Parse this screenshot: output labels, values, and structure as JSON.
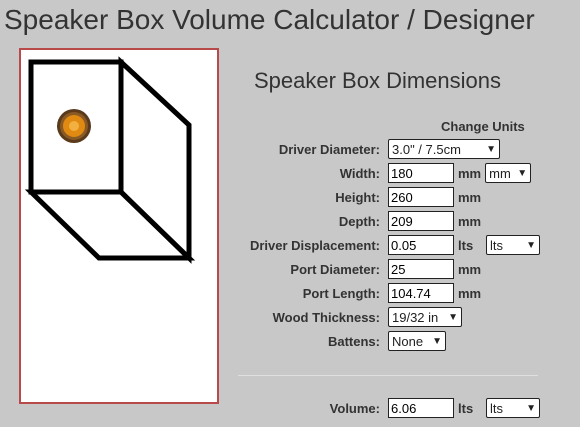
{
  "page": {
    "title": "Speaker Box Volume Calculator / Designer"
  },
  "form": {
    "title": "Speaker Box Dimensions",
    "change_units_label": "Change Units",
    "driver_diameter": {
      "label": "Driver Diameter:",
      "value": "3.0\" / 7.5cm"
    },
    "width": {
      "label": "Width:",
      "value": "180",
      "unit": "mm",
      "unit_select": "mm"
    },
    "height": {
      "label": "Height:",
      "value": "260",
      "unit": "mm"
    },
    "depth": {
      "label": "Depth:",
      "value": "209",
      "unit": "mm"
    },
    "driver_displacement": {
      "label": "Driver Displacement:",
      "value": "0.05",
      "unit": "lts",
      "unit_select": "lts"
    },
    "port_diameter": {
      "label": "Port Diameter:",
      "value": "25",
      "unit": "mm"
    },
    "port_length": {
      "label": "Port Length:",
      "value": "104.74",
      "unit": "mm"
    },
    "wood_thickness": {
      "label": "Wood Thickness:",
      "value": "19/32 in"
    },
    "battens": {
      "label": "Battens:",
      "value": "None"
    },
    "volume": {
      "label": "Volume:",
      "value": "6.06",
      "unit": "lts",
      "unit_select": "lts"
    }
  },
  "colors": {
    "preview_border": "#b94a4a",
    "driver_orange": "#e08a12"
  }
}
